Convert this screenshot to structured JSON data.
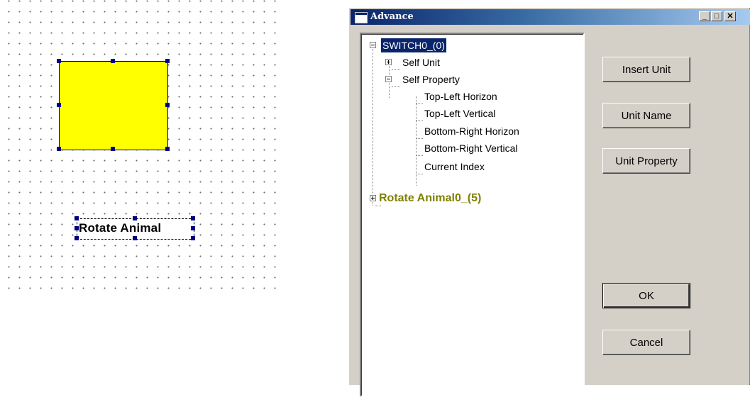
{
  "canvas": {
    "text_widget_label": "Rotate Animal",
    "shape_fill": "#ffff00",
    "handle_color": "#000080"
  },
  "dialog": {
    "title": "Advance",
    "caption_buttons": {
      "minimize": "_",
      "maximize": "□",
      "close": "✕"
    },
    "tree": {
      "root": "SWITCH0_(0)",
      "children": [
        "Self Unit",
        "Self Property"
      ],
      "properties": [
        "Top-Left Horizon",
        "Top-Left Vertical",
        "Bottom-Right Horizon",
        "Bottom-Right Vertical",
        "Current Index"
      ],
      "second_root": "Rotate Animal0_(5)",
      "folder_color": "#808000"
    },
    "buttons": {
      "insert_unit": "Insert Unit",
      "unit_name": "Unit Name",
      "unit_property": "Unit Property",
      "ok": "OK",
      "cancel": "Cancel"
    }
  }
}
